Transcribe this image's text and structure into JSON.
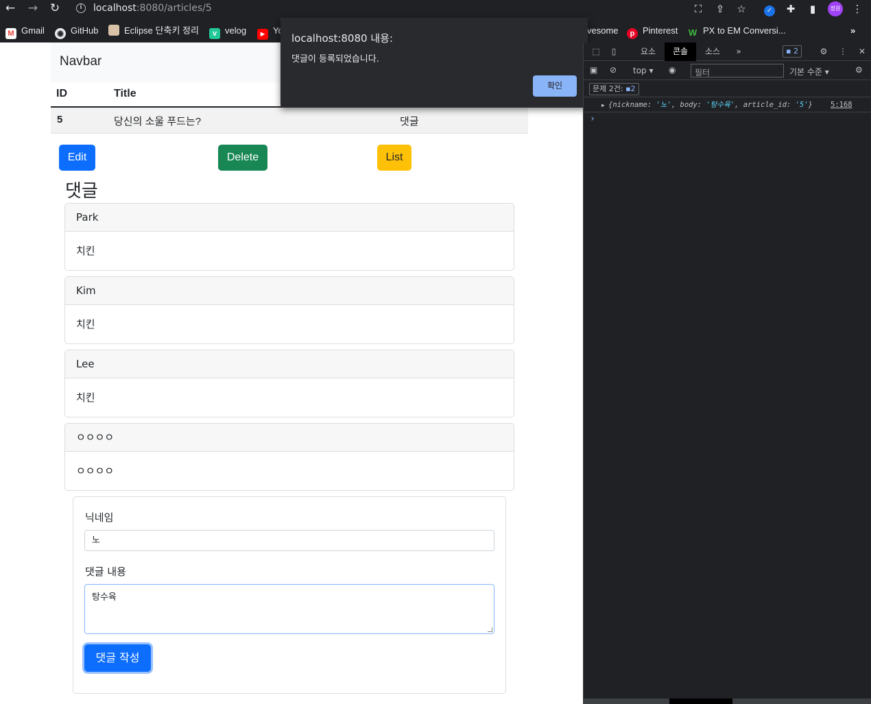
{
  "browser": {
    "url_host": "localhost",
    "url_path": ":8080/articles/5",
    "avatar_text": "정원",
    "bookmarks": [
      {
        "label": "Gmail",
        "icon": "gmail-icon"
      },
      {
        "label": "GitHub",
        "icon": "github-icon"
      },
      {
        "label": "Eclipse 단축키 정리",
        "icon": "eclipse-icon"
      },
      {
        "label": "velog",
        "icon": "velog-icon"
      },
      {
        "label": "Yo",
        "icon": "youtube-icon"
      },
      {
        "label": "vesome",
        "icon": "fontawesome-icon"
      },
      {
        "label": "Pinterest",
        "icon": "pinterest-icon"
      },
      {
        "label": "PX to EM Conversi...",
        "icon": "w-icon"
      }
    ],
    "more": "»"
  },
  "page": {
    "navbar_brand": "Navbar",
    "table": {
      "headers": [
        "ID",
        "Title"
      ],
      "row": {
        "id": "5",
        "title": "당신의 소울 푸드는?",
        "content": "댓글"
      }
    },
    "buttons": {
      "edit": "Edit",
      "delete": "Delete",
      "list": "List"
    },
    "comments_heading": "댓글",
    "comments": [
      {
        "nickname": "Park",
        "body": "치킨"
      },
      {
        "nickname": "Kim",
        "body": "치킨"
      },
      {
        "nickname": "Lee",
        "body": "치킨"
      },
      {
        "nickname": "ㅇㅇㅇㅇ",
        "body": "ㅇㅇㅇㅇ"
      }
    ],
    "form": {
      "nickname_label": "닉네임",
      "nickname_value": "노",
      "body_label": "댓글 내용",
      "body_value": "탕수육",
      "submit": "댓글 작성"
    }
  },
  "dialog": {
    "title": "localhost:8080 내용:",
    "message": "댓글이 등록되었습니다.",
    "ok": "확인"
  },
  "devtools": {
    "tabs": [
      "요소",
      "콘솔",
      "소스"
    ],
    "active_tab": "콘솔",
    "tabs_more": "»",
    "issues_badge": "2",
    "context": "top",
    "filter_placeholder": "필터",
    "levels": "기본 수준",
    "issues_label": "문제 2건:",
    "issues_count": "2",
    "log": {
      "prefix": "{nickname: ",
      "nickname": "'노'",
      "body_key": ", body: ",
      "body": "'탕수육'",
      "aid_key": ", article_id: ",
      "article_id": "'5'",
      "suffix": "}",
      "source": "5:168"
    },
    "prompt": "›"
  },
  "colors": {
    "primary": "#0d6efd",
    "success": "#198754",
    "warning": "#ffc107",
    "dialog_ok": "#8ab4f8",
    "devtools_bg": "#202124"
  }
}
